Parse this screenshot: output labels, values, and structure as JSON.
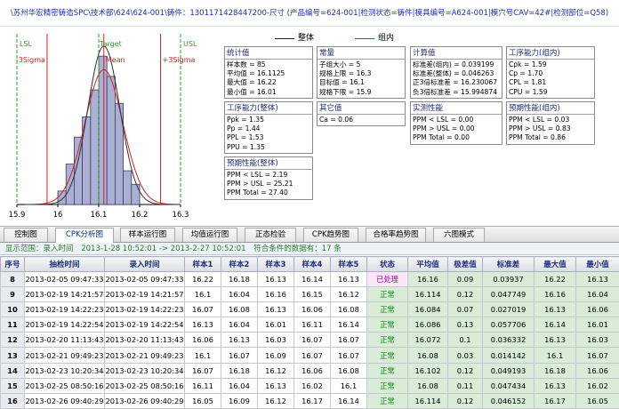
{
  "title_bar": {
    "text": "\\苏州华宏精密铸造SPC\\技术部\\624\\624-001\\铸件：1301171428447200-尺寸   (产品编号=624-001|检测状态=铸件|模具编号=A624-001|模穴号CAV=42#|检测部位=Q58)"
  },
  "histogram": {
    "labels": {
      "lsl": "LSL",
      "target": "Target",
      "usl": "USL",
      "minus3": "-3Sigma",
      "mean": "Mean",
      "plus3": "+3Sigma"
    },
    "x_ticks": [
      "15.9",
      "16",
      "16.1",
      "16.2",
      "16.3"
    ],
    "x_tick_values": [
      15.9,
      16.0,
      16.1,
      16.2,
      16.3
    ],
    "lines": {
      "lsl": 15.9,
      "usl": 16.3,
      "target": 16.1,
      "mean": 16.1125,
      "minus3": 15.9738,
      "plus3": 16.2512
    },
    "bars": [
      {
        "x0": 16.0,
        "x1": 16.02,
        "count": 2
      },
      {
        "x0": 16.02,
        "x1": 16.04,
        "count": 6
      },
      {
        "x0": 16.04,
        "x1": 16.06,
        "count": 10
      },
      {
        "x0": 16.06,
        "x1": 16.08,
        "count": 13
      },
      {
        "x0": 16.08,
        "x1": 16.1,
        "count": 17
      },
      {
        "x0": 16.1,
        "x1": 16.12,
        "count": 22
      },
      {
        "x0": 16.12,
        "x1": 16.14,
        "count": 19
      },
      {
        "x0": 16.14,
        "x1": 16.16,
        "count": 15
      },
      {
        "x0": 16.16,
        "x1": 16.18,
        "count": 5
      },
      {
        "x0": 16.18,
        "x1": 16.2,
        "count": 3
      }
    ],
    "colors": {
      "limit": "#2e9e2e",
      "sigma": "#d02020",
      "mean": "#d02020",
      "target": "#2e9e2e",
      "bar": "#a9b0d3",
      "bar_border": "#3c3c60",
      "curve_overall": "#d02020",
      "curve_within": "#303030"
    }
  },
  "legend": {
    "overall": "整体",
    "within": "组内",
    "overall_color": "#202020",
    "within_color": "#d02020"
  },
  "boxes": {
    "stats": {
      "title": "统计值",
      "lines": [
        "样本数 = 85",
        "平均值 = 16.1125",
        "最大值 = 16.22",
        "最小值 = 16.01"
      ]
    },
    "constants": {
      "title": "常量",
      "lines": [
        "子组大小 = 5",
        "规格上限 = 16.3",
        "目标值 = 16.1",
        "规格下限 = 15.9"
      ]
    },
    "calc": {
      "title": "计算值",
      "lines": [
        "标准差(组内) = 0.039199",
        "标准差(整体) = 0.046263",
        "正3倍标准差 = 16.230067",
        "负3倍标准差 = 15.994874"
      ]
    },
    "within_cap": {
      "title": "工序能力(组内)",
      "lines": [
        "Cpk = 1.59",
        "Cp = 1.70",
        "CPL = 1.81",
        "CPU = 1.59"
      ]
    },
    "overall_cap": {
      "title": "工序能力(整体)",
      "lines": [
        "Ppk = 1.35",
        "Pp = 1.44",
        "PPL = 1.53",
        "PPU = 1.35"
      ]
    },
    "other": {
      "title": "其它值",
      "lines": [
        "Ca = 0.06"
      ]
    },
    "measured": {
      "title": "实测性能",
      "lines": [
        "PPM < LSL = 0.00",
        "PPM > USL = 0.00",
        "PPM Total = 0.00"
      ]
    },
    "expected_within": {
      "title": "预期性能(组内)",
      "lines": [
        "PPM < LSL = 0.03",
        "PPM > USL = 0.83",
        "PPM Total = 0.86"
      ]
    },
    "expected_overall": {
      "title": "预期性能(整体)",
      "lines": [
        "PPM < LSL = 2.19",
        "PPM > USL = 25.21",
        "PPM Total = 27.40"
      ]
    }
  },
  "tabs": [
    {
      "label": "控制图"
    },
    {
      "label": "CPK分析图"
    },
    {
      "label": "样本运行图"
    },
    {
      "label": "均值运行图"
    },
    {
      "label": "正态检验"
    },
    {
      "label": "CPK趋势图"
    },
    {
      "label": "合格率趋势图"
    },
    {
      "label": "六图模式"
    }
  ],
  "range_bar": {
    "label": "显示范围：录入时间",
    "range": "2013-1-28 10:52:01 -> 2013-2-27 10:52:01",
    "count": "符合条件的数据有：17 条"
  },
  "table": {
    "headers": [
      "序号",
      "抽检时间",
      "录入时间",
      "样本1",
      "样本2",
      "样本3",
      "样本4",
      "样本5",
      "状态",
      "平均值",
      "极差值",
      "标准差",
      "最大值",
      "最小值"
    ],
    "rows": [
      [
        "8",
        "2013-02-05 09:47:33",
        "2013-02-05 09:47:33",
        "16.22",
        "16.18",
        "16.13",
        "16.14",
        "16.13",
        "已处理",
        "16.16",
        "0.09",
        "0.03937",
        "16.22",
        "16.13"
      ],
      [
        "9",
        "2013-02-19 14:21:57",
        "2013-02-19 14:21:57",
        "16.1",
        "16.04",
        "16.16",
        "16.15",
        "16.12",
        "正常",
        "16.114",
        "0.12",
        "0.047749",
        "16.16",
        "16.04"
      ],
      [
        "10",
        "2013-02-19 14:22:23",
        "2013-02-19 14:22:23",
        "16.07",
        "16.08",
        "16.13",
        "16.06",
        "16.08",
        "正常",
        "16.084",
        "0.07",
        "0.027019",
        "16.13",
        "16.06"
      ],
      [
        "11",
        "2013-02-19 14:22:54",
        "2013-02-19 14:22:54",
        "16.13",
        "16.04",
        "16.01",
        "16.11",
        "16.14",
        "正常",
        "16.086",
        "0.13",
        "0.057706",
        "16.14",
        "16.01"
      ],
      [
        "12",
        "2013-02-20 11:13:43",
        "2013-02-20 11:13:43",
        "16.06",
        "16.13",
        "16.03",
        "16.07",
        "16.07",
        "正常",
        "16.072",
        "0.1",
        "0.036332",
        "16.13",
        "16.03"
      ],
      [
        "13",
        "2013-02-21 09:49:23",
        "2013-02-21 09:49:23",
        "16.1",
        "16.07",
        "16.09",
        "16.07",
        "16.07",
        "正常",
        "16.08",
        "0.03",
        "0.014142",
        "16.1",
        "16.07"
      ],
      [
        "14",
        "2013-02-23 10:20:34",
        "2013-02-23 10:20:34",
        "16.07",
        "16.18",
        "16.12",
        "16.06",
        "16.08",
        "正常",
        "16.102",
        "0.12",
        "0.049193",
        "16.18",
        "16.06"
      ],
      [
        "15",
        "2013-02-25 08:50:16",
        "2013-02-25 08:50:16",
        "16.11",
        "16.04",
        "16.13",
        "16.02",
        "16.1",
        "正常",
        "16.08",
        "0.11",
        "0.047434",
        "16.13",
        "16.02"
      ],
      [
        "16",
        "2013-02-26 09:40:29",
        "2013-02-26 09:40:29",
        "16.05",
        "16.09",
        "16.12",
        "16.17",
        "16.14",
        "正常",
        "16.114",
        "0.12",
        "0.046152",
        "16.17",
        "16.05"
      ],
      [
        "17",
        "2013-02-27 10:52:01",
        "2013-02-27 10:52:01",
        "16.07",
        "16.13",
        "16.12",
        "16.07",
        "16.06",
        "正常",
        "16.09",
        "0.07",
        "0.032404",
        "16.13",
        "16.06"
      ]
    ]
  }
}
